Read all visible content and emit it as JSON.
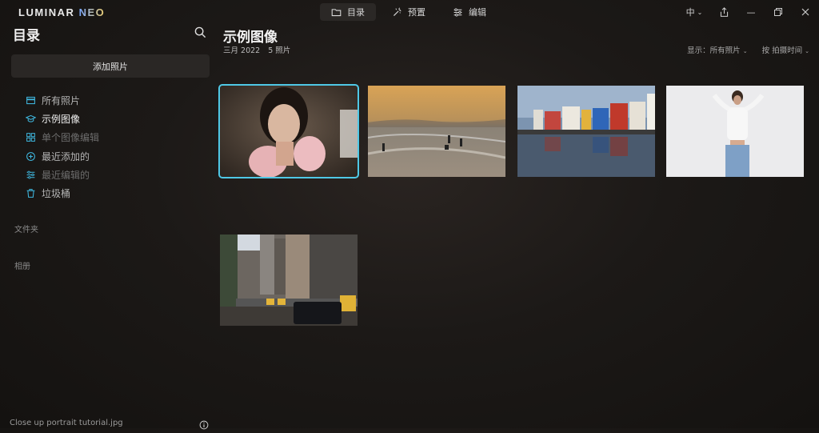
{
  "app": {
    "logo_main": "LUMINAR",
    "logo_neo": "NEO"
  },
  "tabs": [
    {
      "label": "目录",
      "icon": "folder-icon",
      "active": true
    },
    {
      "label": "预置",
      "icon": "magic-wand-icon",
      "active": false
    },
    {
      "label": "编辑",
      "icon": "sliders-icon",
      "active": false
    }
  ],
  "window": {
    "lang": "中"
  },
  "sidebar": {
    "title": "目录",
    "add_button": "添加照片",
    "items": [
      {
        "label": "所有照片",
        "icon": "stack-icon"
      },
      {
        "label": "示例图像",
        "icon": "graduation-cap-icon"
      },
      {
        "label": "单个图像编辑",
        "icon": "grid-icon"
      },
      {
        "label": "最近添加的",
        "icon": "plus-circle-icon"
      },
      {
        "label": "最近编辑的",
        "icon": "sliders-icon"
      },
      {
        "label": "垃圾桶",
        "icon": "trash-icon"
      }
    ],
    "folders_label": "文件夹",
    "albums_label": "相册",
    "footer_file": "Close up portrait tutorial.jpg"
  },
  "main": {
    "title": "示例图像",
    "date": "三月 2022",
    "count": "5 照片",
    "show_label": "显示：",
    "show_value": "所有照片",
    "sort_label": "按 拍摄时间"
  },
  "photos": [
    {
      "name": "portrait-woman",
      "selected": true
    },
    {
      "name": "beach-sunset",
      "selected": false
    },
    {
      "name": "harbor-houses",
      "selected": false
    },
    {
      "name": "woman-white-wall",
      "selected": false
    },
    {
      "name": "city-street",
      "selected": false
    }
  ],
  "colors": {
    "accent": "#4fc8e6"
  }
}
